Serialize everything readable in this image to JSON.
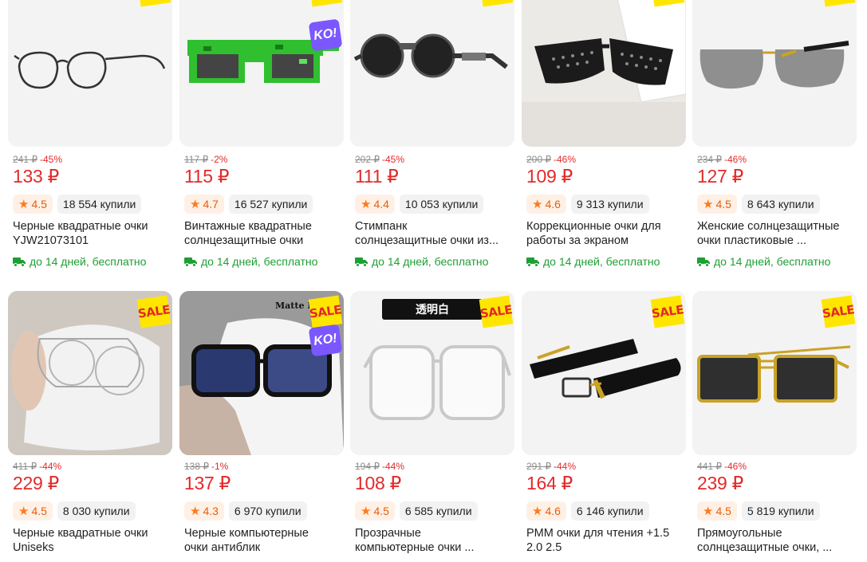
{
  "delivery_text": "до 14 дней, бесплатно",
  "sale_label": "SALE",
  "ko_label": "KO!",
  "black_tag": "透明白",
  "matte_text": "Matte B",
  "colors": {
    "price": "#e22a2a",
    "rating": "#e25f0f",
    "delivery": "#1e9f34",
    "sale_bg": "#ffe600",
    "ko_bg": "#7a57ff"
  },
  "products": [
    {
      "old_price": "241 ₽",
      "discount": "-45%",
      "price": "133 ₽",
      "rating": "4.5",
      "bought": "18 554 купили",
      "title_1": "Черные квадратные очки",
      "title_2": "YJW21073101"
    },
    {
      "old_price": "117 ₽",
      "discount": "-2%",
      "price": "115 ₽",
      "rating": "4.7",
      "bought": "16 527 купили",
      "title_1": "Винтажные квадратные",
      "title_2": "солнцезащитные очки"
    },
    {
      "old_price": "202 ₽",
      "discount": "-45%",
      "price": "111 ₽",
      "rating": "4.4",
      "bought": "10 053 купили",
      "title_1": "Стимпанк",
      "title_2": "солнцезащитные очки из..."
    },
    {
      "old_price": "200 ₽",
      "discount": "-46%",
      "price": "109 ₽",
      "rating": "4.6",
      "bought": "9 313 купили",
      "title_1": "Коррекционные очки для",
      "title_2": "работы за экраном"
    },
    {
      "old_price": "234 ₽",
      "discount": "-46%",
      "price": "127 ₽",
      "rating": "4.5",
      "bought": "8 643 купили",
      "title_1": "Женские солнцезащитные",
      "title_2": "очки пластиковые ..."
    },
    {
      "old_price": "411 ₽",
      "discount": "-44%",
      "price": "229 ₽",
      "rating": "4.5",
      "bought": "8 030 купили",
      "title_1": "Черные квадратные очки",
      "title_2": "Uniseks"
    },
    {
      "old_price": "138 ₽",
      "discount": "-1%",
      "price": "137 ₽",
      "rating": "4.3",
      "bought": "6 970 купили",
      "title_1": "Черные компьютерные",
      "title_2": "очки антиблик"
    },
    {
      "old_price": "194 ₽",
      "discount": "-44%",
      "price": "108 ₽",
      "rating": "4.5",
      "bought": "6 585 купили",
      "title_1": "Прозрачные",
      "title_2": "компьютерные очки ..."
    },
    {
      "old_price": "291 ₽",
      "discount": "-44%",
      "price": "164 ₽",
      "rating": "4.6",
      "bought": "6 146 купили",
      "title_1": "PMM очки для чтения +1.5",
      "title_2": "2.0 2.5"
    },
    {
      "old_price": "441 ₽",
      "discount": "-46%",
      "price": "239 ₽",
      "rating": "4.5",
      "bought": "5 819 купили",
      "title_1": "Прямоугольные",
      "title_2": "солнцезащитные очки, ..."
    }
  ]
}
